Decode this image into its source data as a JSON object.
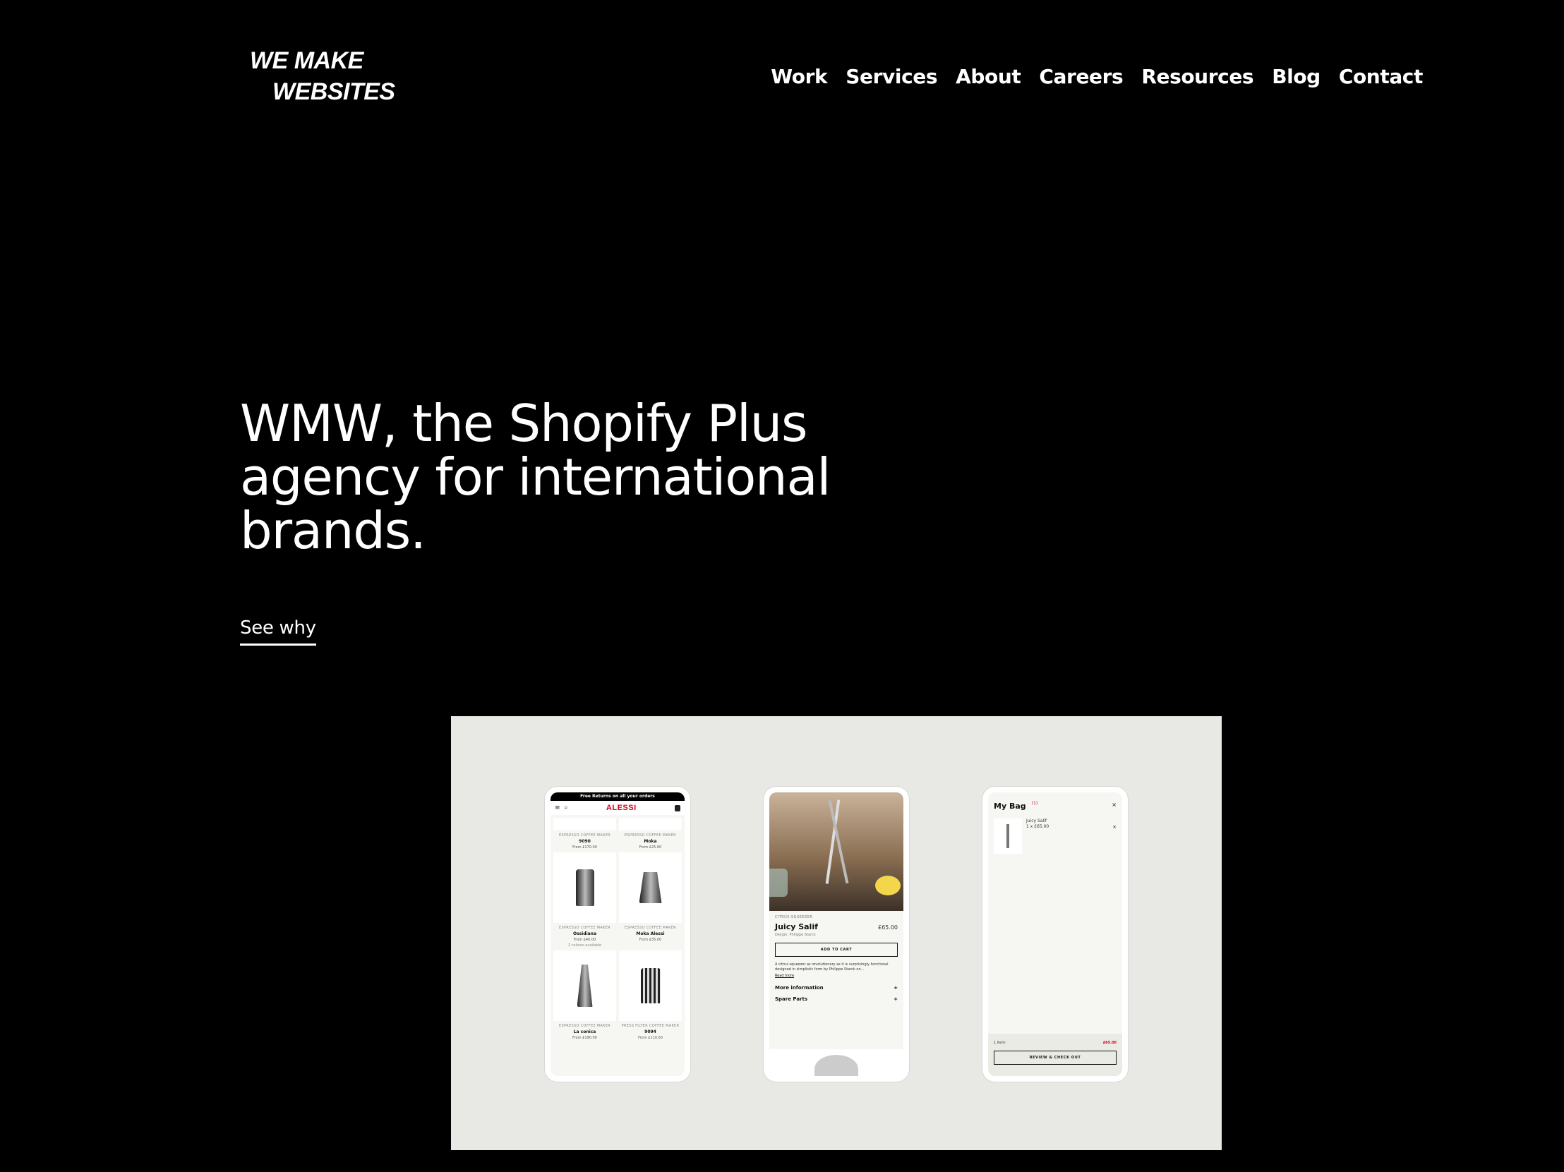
{
  "logo": {
    "line1": "WE MAKE",
    "line2": "WEBSITES"
  },
  "nav": {
    "items": [
      {
        "label": "Work"
      },
      {
        "label": "Services"
      },
      {
        "label": "About"
      },
      {
        "label": "Careers"
      },
      {
        "label": "Resources"
      },
      {
        "label": "Blog"
      },
      {
        "label": "Contact"
      }
    ]
  },
  "hero": {
    "title": "WMW, the Shopify Plus agency for international brands.",
    "cta": "See why"
  },
  "showcase": {
    "phone1": {
      "banner": "Free Returns on all your orders",
      "brand": "ALESSI",
      "products": [
        {
          "category": "ESPRESSO COFFEE MAKER",
          "name": "9090",
          "price": "From £170.00",
          "extra": ""
        },
        {
          "category": "ESPRESSO COFFEE MAKER",
          "name": "Moka",
          "price": "From £25.00",
          "extra": ""
        },
        {
          "category": "ESPRESSO COFFEE MAKER",
          "name": "Ossidiana",
          "price": "From £40.00",
          "extra": "2 colours available"
        },
        {
          "category": "ESPRESSO COFFEE MAKER",
          "name": "Moka Alessi",
          "price": "From £35.00",
          "extra": ""
        },
        {
          "category": "ESPRESSO COFFEE MAKER",
          "name": "La conica",
          "price": "From £190.00",
          "extra": ""
        },
        {
          "category": "PRESS FILTER COFFEE MAKER",
          "name": "9094",
          "price": "From £110.00",
          "extra": ""
        }
      ]
    },
    "phone2": {
      "category": "CITRUS-SQUEEZER",
      "title": "Juicy Salif",
      "price": "£65.00",
      "design": "Design: Philippe Starck",
      "add_to_cart": "ADD TO CART",
      "description": "A citrus squeezer as revolutionary as it is surprisingly functional designed in simplistic form by Philippe Starck on...",
      "read_more": "Read more",
      "accordions": [
        {
          "label": "More information"
        },
        {
          "label": "Spare Parts"
        }
      ]
    },
    "phone3": {
      "title": "My Bag",
      "count": "(1)",
      "item_name": "Juicy Salif",
      "item_qty": "1 x £65.00",
      "items_label": "1 item:",
      "total": "£65.00",
      "checkout": "REVIEW & CHECK OUT"
    }
  },
  "colors": {
    "background": "#000000",
    "text": "#ffffff",
    "showcase_bg": "#e8e8e4",
    "alessi_red": "#d0021b"
  }
}
